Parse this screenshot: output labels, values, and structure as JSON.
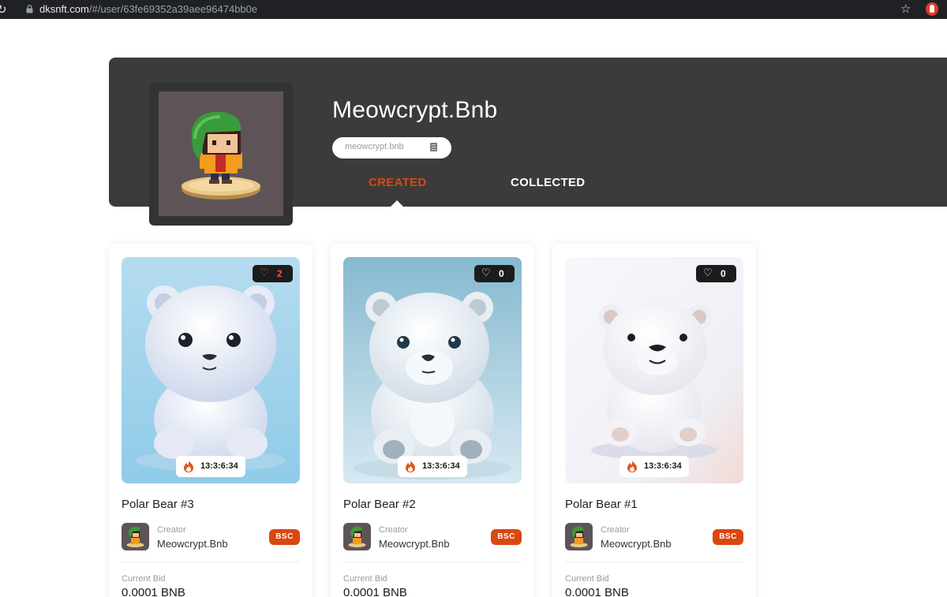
{
  "browser": {
    "url_host": "dksnft.com",
    "url_path": "/#/user/63fe69352a39aee96474bb0e"
  },
  "profile": {
    "name": "Meowcrypt.Bnb",
    "address_display": "meowcrypt.bnb"
  },
  "tabs": [
    {
      "label": "CREATED",
      "active": true
    },
    {
      "label": "COLLECTED",
      "active": false
    }
  ],
  "colors": {
    "accent": "#d9480f",
    "banner_bg": "#3b3b3b"
  },
  "cards": [
    {
      "title": "Polar Bear #3",
      "likes": "2",
      "liked": true,
      "timer": "13:3:6:34",
      "creator_label": "Creator",
      "creator_name": "Meowcrypt.Bnb",
      "chain": "BSC",
      "bid_label": "Current Bid",
      "bid_value": "0.0001 BNB"
    },
    {
      "title": "Polar Bear #2",
      "likes": "0",
      "liked": false,
      "timer": "13:3:6:34",
      "creator_label": "Creator",
      "creator_name": "Meowcrypt.Bnb",
      "chain": "BSC",
      "bid_label": "Current Bid",
      "bid_value": "0.0001 BNB"
    },
    {
      "title": "Polar Bear #1",
      "likes": "0",
      "liked": false,
      "timer": "13:3:6:34",
      "creator_label": "Creator",
      "creator_name": "Meowcrypt.Bnb",
      "chain": "BSC",
      "bid_label": "Current Bid",
      "bid_value": "0.0001 BNB"
    }
  ],
  "icons": {
    "reload": "reload-icon",
    "lock": "lock-icon",
    "star": "bookmark-star-icon",
    "extension": "extension-icon",
    "copy": "copy-icon",
    "heart": "heart-icon",
    "flame": "flame-icon"
  }
}
